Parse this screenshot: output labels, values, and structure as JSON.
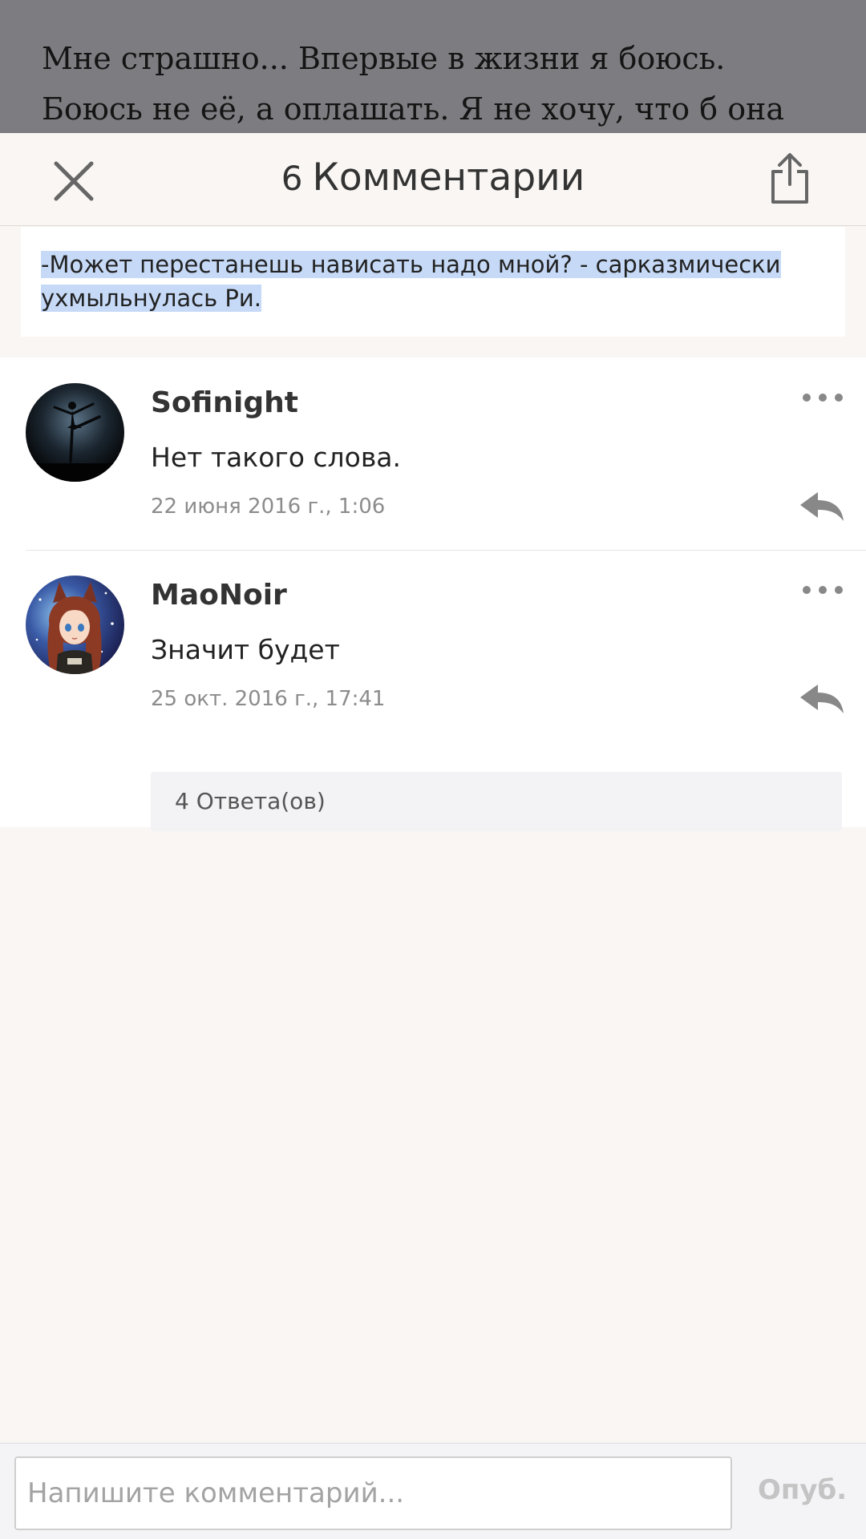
{
  "reader": {
    "line1": "Мне страшно... Впервые в жизни я боюсь.",
    "line2": "Боюсь не её, а оплашать. Я не хочу, что б она"
  },
  "header": {
    "count": "6",
    "title": "Комментарии",
    "close_icon": "close-icon",
    "share_icon": "share-icon"
  },
  "quote": {
    "line1": "-Может перестанешь нависать надо мной? - сарказмически",
    "line2": "ухмыльнулась Ри.",
    "highlight_color": "#c6daf7"
  },
  "comments": [
    {
      "author": "Sofinight",
      "text": "Нет такого слова.",
      "timestamp": "22 июня 2016 г., 1:06"
    },
    {
      "author": "MaoNoir",
      "text": "Значит будет",
      "timestamp": "25 окт. 2016 г., 17:41",
      "replies_label": "4 Ответа(ов)"
    }
  ],
  "footer": {
    "input_placeholder": "Напишите комментарий...",
    "input_value": "",
    "publish_label": "Опуб."
  }
}
